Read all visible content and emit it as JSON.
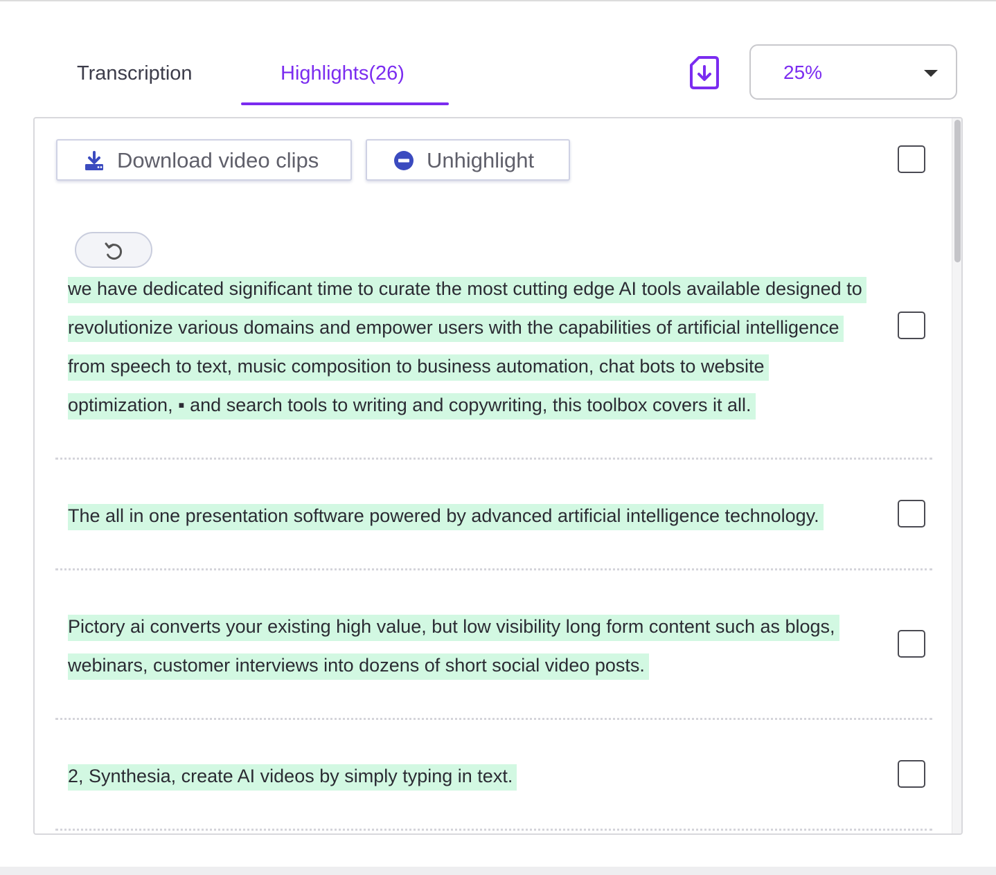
{
  "tabs": {
    "transcription": "Transcription",
    "highlights": "Highlights(26)"
  },
  "export_icon": "file-download-icon",
  "zoom": {
    "value": "25%",
    "icon": "caret-down-icon"
  },
  "actions": {
    "download_label": "Download video clips",
    "download_icon": "download-icon",
    "unhighlight_label": "Unhighlight",
    "unhighlight_icon": "minus-circle-icon",
    "undo_icon": "undo-icon"
  },
  "highlights": [
    {
      "text": "we have dedicated significant time to curate the most cutting edge AI tools available designed to revolutionize various domains and empower users with the capabilities of artificial intelligence from speech to text, music composition to business automation, chat bots to website optimization, ▪ and search tools to writing and copywriting, this toolbox covers it all."
    },
    {
      "text": "The all in one presentation software powered by advanced artificial intelligence technology."
    },
    {
      "text": "Pictory ai converts your existing high value, but low visibility long form content such as blogs, webinars, customer interviews into dozens of short social video posts."
    },
    {
      "text": "2, Synthesia, create AI videos by simply typing in text."
    }
  ],
  "colors": {
    "accent": "#7b2cf0",
    "highlight": "#d2f8e2",
    "icon_blue": "#3b4bbf"
  }
}
